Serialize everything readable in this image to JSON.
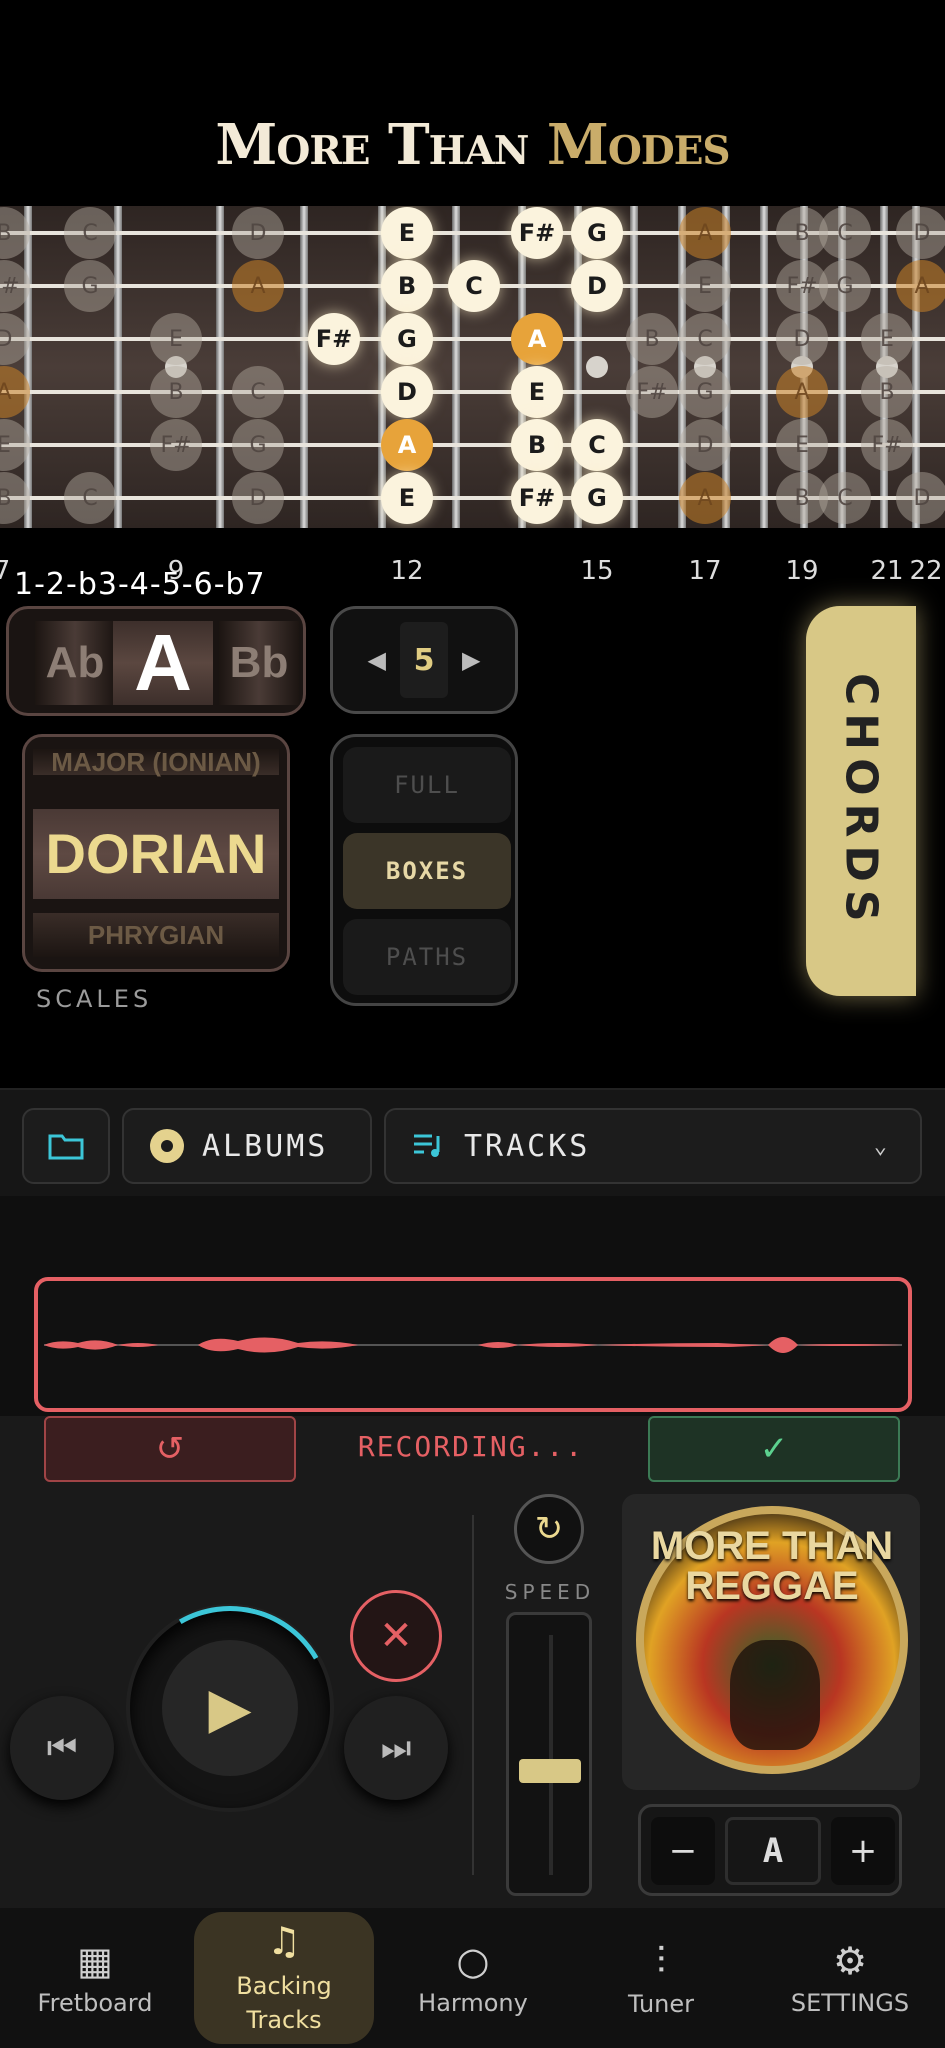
{
  "app": {
    "title_part1": "More Than",
    "title_part2": "Modes"
  },
  "fretboard": {
    "fret_numbers": [
      "7",
      "9",
      "12",
      "15",
      "17",
      "19",
      "21",
      "22"
    ],
    "formula": "1-2-b3-4-5-6-b7",
    "notes_active": [
      {
        "string": 1,
        "label": "E"
      },
      {
        "string": 1,
        "label": "F#"
      },
      {
        "string": 1,
        "label": "G"
      },
      {
        "string": 2,
        "label": "B"
      },
      {
        "string": 2,
        "label": "C"
      },
      {
        "string": 2,
        "label": "D"
      },
      {
        "string": 3,
        "label": "F#"
      },
      {
        "string": 3,
        "label": "G"
      },
      {
        "string": 3,
        "label": "A"
      },
      {
        "string": 4,
        "label": "D"
      },
      {
        "string": 4,
        "label": "E"
      },
      {
        "string": 5,
        "label": "A"
      },
      {
        "string": 5,
        "label": "B"
      },
      {
        "string": 5,
        "label": "C"
      },
      {
        "string": 6,
        "label": "E"
      },
      {
        "string": 6,
        "label": "F#"
      },
      {
        "string": 6,
        "label": "G"
      }
    ]
  },
  "key_selector": {
    "prev": "Ab",
    "current": "A",
    "next": "Bb"
  },
  "position": {
    "value": "5"
  },
  "scale_selector": {
    "above": "MAJOR (IONIAN)",
    "current": "DORIAN",
    "below": "PHRYGIAN",
    "label": "SCALES"
  },
  "view_modes": {
    "items": [
      "FULL",
      "BOXES",
      "PATHS"
    ],
    "selected": "BOXES"
  },
  "chords_button": "CHORDS",
  "toolbar": {
    "albums_label": "ALBUMS",
    "tracks_label": "TRACKS"
  },
  "recording": {
    "status": "RECORDING..."
  },
  "player": {
    "speed_label": "SPEED",
    "speed_level": 0.5
  },
  "album": {
    "title": "MORE THAN REGGAE"
  },
  "key_adjust": {
    "minus": "−",
    "value": "A",
    "plus": "+"
  },
  "nav": {
    "items": [
      {
        "label": "Fretboard",
        "icon": "grid-icon"
      },
      {
        "label": "Backing Tracks",
        "icon": "music-library-icon"
      },
      {
        "label": "Harmony",
        "icon": "circle-icon"
      },
      {
        "label": "Tuner",
        "icon": "waveform-icon"
      },
      {
        "label": "SETTINGS",
        "icon": "gear-icon"
      }
    ],
    "active": "Backing Tracks"
  },
  "colors": {
    "accent": "#d8c886",
    "record": "#e56064",
    "confirm": "#5cd18f",
    "root_note": "#e7a33a",
    "teal": "#3cc6d8"
  }
}
